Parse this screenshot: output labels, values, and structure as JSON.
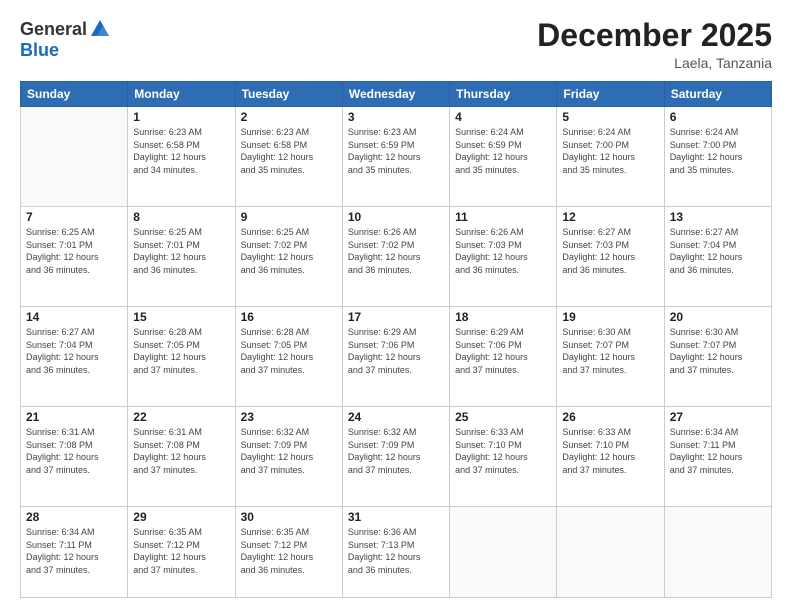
{
  "header": {
    "logo_general": "General",
    "logo_blue": "Blue",
    "month_title": "December 2025",
    "subtitle": "Laela, Tanzania"
  },
  "days_of_week": [
    "Sunday",
    "Monday",
    "Tuesday",
    "Wednesday",
    "Thursday",
    "Friday",
    "Saturday"
  ],
  "weeks": [
    [
      {
        "day": "",
        "info": ""
      },
      {
        "day": "1",
        "info": "Sunrise: 6:23 AM\nSunset: 6:58 PM\nDaylight: 12 hours\nand 34 minutes."
      },
      {
        "day": "2",
        "info": "Sunrise: 6:23 AM\nSunset: 6:58 PM\nDaylight: 12 hours\nand 35 minutes."
      },
      {
        "day": "3",
        "info": "Sunrise: 6:23 AM\nSunset: 6:59 PM\nDaylight: 12 hours\nand 35 minutes."
      },
      {
        "day": "4",
        "info": "Sunrise: 6:24 AM\nSunset: 6:59 PM\nDaylight: 12 hours\nand 35 minutes."
      },
      {
        "day": "5",
        "info": "Sunrise: 6:24 AM\nSunset: 7:00 PM\nDaylight: 12 hours\nand 35 minutes."
      },
      {
        "day": "6",
        "info": "Sunrise: 6:24 AM\nSunset: 7:00 PM\nDaylight: 12 hours\nand 35 minutes."
      }
    ],
    [
      {
        "day": "7",
        "info": "Sunrise: 6:25 AM\nSunset: 7:01 PM\nDaylight: 12 hours\nand 36 minutes."
      },
      {
        "day": "8",
        "info": "Sunrise: 6:25 AM\nSunset: 7:01 PM\nDaylight: 12 hours\nand 36 minutes."
      },
      {
        "day": "9",
        "info": "Sunrise: 6:25 AM\nSunset: 7:02 PM\nDaylight: 12 hours\nand 36 minutes."
      },
      {
        "day": "10",
        "info": "Sunrise: 6:26 AM\nSunset: 7:02 PM\nDaylight: 12 hours\nand 36 minutes."
      },
      {
        "day": "11",
        "info": "Sunrise: 6:26 AM\nSunset: 7:03 PM\nDaylight: 12 hours\nand 36 minutes."
      },
      {
        "day": "12",
        "info": "Sunrise: 6:27 AM\nSunset: 7:03 PM\nDaylight: 12 hours\nand 36 minutes."
      },
      {
        "day": "13",
        "info": "Sunrise: 6:27 AM\nSunset: 7:04 PM\nDaylight: 12 hours\nand 36 minutes."
      }
    ],
    [
      {
        "day": "14",
        "info": "Sunrise: 6:27 AM\nSunset: 7:04 PM\nDaylight: 12 hours\nand 36 minutes."
      },
      {
        "day": "15",
        "info": "Sunrise: 6:28 AM\nSunset: 7:05 PM\nDaylight: 12 hours\nand 37 minutes."
      },
      {
        "day": "16",
        "info": "Sunrise: 6:28 AM\nSunset: 7:05 PM\nDaylight: 12 hours\nand 37 minutes."
      },
      {
        "day": "17",
        "info": "Sunrise: 6:29 AM\nSunset: 7:06 PM\nDaylight: 12 hours\nand 37 minutes."
      },
      {
        "day": "18",
        "info": "Sunrise: 6:29 AM\nSunset: 7:06 PM\nDaylight: 12 hours\nand 37 minutes."
      },
      {
        "day": "19",
        "info": "Sunrise: 6:30 AM\nSunset: 7:07 PM\nDaylight: 12 hours\nand 37 minutes."
      },
      {
        "day": "20",
        "info": "Sunrise: 6:30 AM\nSunset: 7:07 PM\nDaylight: 12 hours\nand 37 minutes."
      }
    ],
    [
      {
        "day": "21",
        "info": "Sunrise: 6:31 AM\nSunset: 7:08 PM\nDaylight: 12 hours\nand 37 minutes."
      },
      {
        "day": "22",
        "info": "Sunrise: 6:31 AM\nSunset: 7:08 PM\nDaylight: 12 hours\nand 37 minutes."
      },
      {
        "day": "23",
        "info": "Sunrise: 6:32 AM\nSunset: 7:09 PM\nDaylight: 12 hours\nand 37 minutes."
      },
      {
        "day": "24",
        "info": "Sunrise: 6:32 AM\nSunset: 7:09 PM\nDaylight: 12 hours\nand 37 minutes."
      },
      {
        "day": "25",
        "info": "Sunrise: 6:33 AM\nSunset: 7:10 PM\nDaylight: 12 hours\nand 37 minutes."
      },
      {
        "day": "26",
        "info": "Sunrise: 6:33 AM\nSunset: 7:10 PM\nDaylight: 12 hours\nand 37 minutes."
      },
      {
        "day": "27",
        "info": "Sunrise: 6:34 AM\nSunset: 7:11 PM\nDaylight: 12 hours\nand 37 minutes."
      }
    ],
    [
      {
        "day": "28",
        "info": "Sunrise: 6:34 AM\nSunset: 7:11 PM\nDaylight: 12 hours\nand 37 minutes."
      },
      {
        "day": "29",
        "info": "Sunrise: 6:35 AM\nSunset: 7:12 PM\nDaylight: 12 hours\nand 37 minutes."
      },
      {
        "day": "30",
        "info": "Sunrise: 6:35 AM\nSunset: 7:12 PM\nDaylight: 12 hours\nand 36 minutes."
      },
      {
        "day": "31",
        "info": "Sunrise: 6:36 AM\nSunset: 7:13 PM\nDaylight: 12 hours\nand 36 minutes."
      },
      {
        "day": "",
        "info": ""
      },
      {
        "day": "",
        "info": ""
      },
      {
        "day": "",
        "info": ""
      }
    ]
  ]
}
